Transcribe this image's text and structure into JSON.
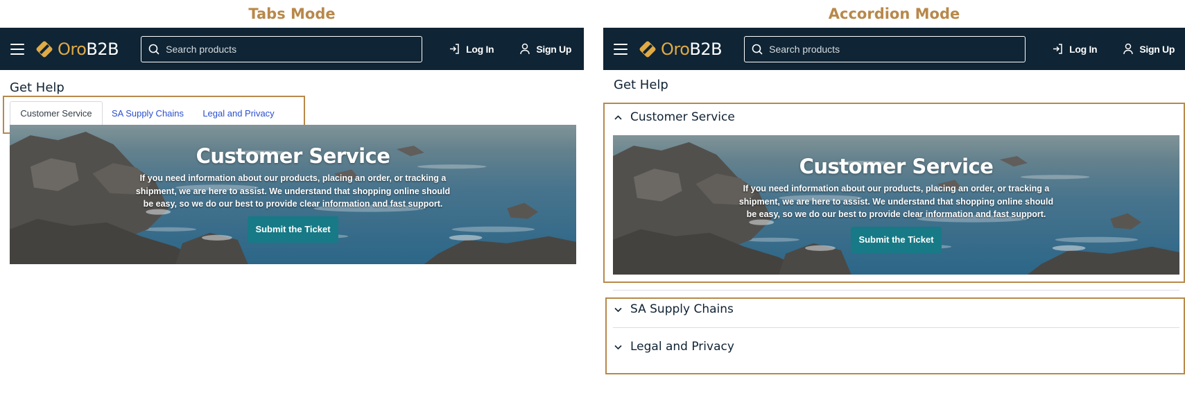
{
  "labels": {
    "tabs_mode": "Tabs Mode",
    "accordion_mode": "Accordion Mode"
  },
  "header": {
    "logo_oro": "Oro",
    "logo_b2b": "B2B",
    "search_placeholder": "Search products",
    "login_label": "Log In",
    "signup_label": "Sign Up"
  },
  "page": {
    "title": "Get Help"
  },
  "sections": [
    {
      "label": "Customer Service",
      "banner_title": "Customer Service",
      "banner_text": "If you need information about our products, placing an order, or tracking a shipment, we are here to assist. We understand that shopping online should be easy, so we do our best to provide clear information and fast support.",
      "button_label": "Submit the Ticket"
    },
    {
      "label": "SA Supply Chains"
    },
    {
      "label": "Legal and Privacy"
    }
  ],
  "colors": {
    "header_bg": "#0f2434",
    "annotation": "#b8884a",
    "logo_accent": "#e0aa45",
    "tab_link": "#2a4fd0",
    "button": "#177a86"
  }
}
